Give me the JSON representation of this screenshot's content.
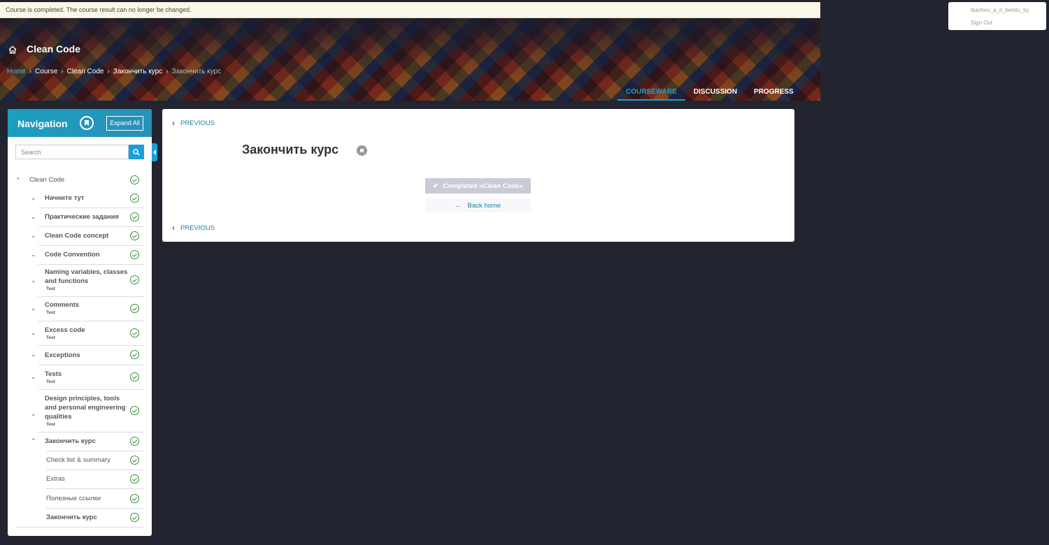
{
  "notice": "Course is completed. The course result can no longer be changed.",
  "user": {
    "name": "tkachev_a_it_belstu_by",
    "signout": "Sign Out"
  },
  "header": {
    "course_title": "Clean Code",
    "breadcrumb": [
      "Home",
      "Course",
      "Clean Code",
      "Закончить курс",
      "Закончить курс"
    ],
    "tabs": [
      "COURSEWARE",
      "DISCUSSION",
      "PROGRESS"
    ],
    "active_tab": "COURSEWARE"
  },
  "sidebar": {
    "title": "Navigation",
    "expand_all": "Expand All",
    "search_placeholder": "Search",
    "root": "Clean Code",
    "sections": [
      {
        "label": "Начните тут",
        "sub": ""
      },
      {
        "label": "Практические задания",
        "sub": ""
      },
      {
        "label": "Clean Code concept",
        "sub": ""
      },
      {
        "label": "Code Convention",
        "sub": ""
      },
      {
        "label": "Naming variables, classes and functions",
        "sub": "Test"
      },
      {
        "label": "Comments",
        "sub": "Test"
      },
      {
        "label": "Excess code",
        "sub": "Test"
      },
      {
        "label": "Exceptions",
        "sub": ""
      },
      {
        "label": "Tests",
        "sub": "Test"
      },
      {
        "label": "Design principles, tools and personal engineering qualities",
        "sub": "Test"
      },
      {
        "label": "Закончить курс",
        "sub": ""
      }
    ],
    "leaves": [
      "Check list & summary",
      "Extras",
      "Полезные ссылки",
      "Закончить курс"
    ]
  },
  "main": {
    "previous": "PREVIOUS",
    "unit_title": "Закончить курс",
    "completed_label": "Completed «Clean Code»",
    "back_home": "Back home"
  },
  "colors": {
    "accent": "#1a9fd6",
    "check": "#3a8f3a",
    "background": "#22242f"
  }
}
